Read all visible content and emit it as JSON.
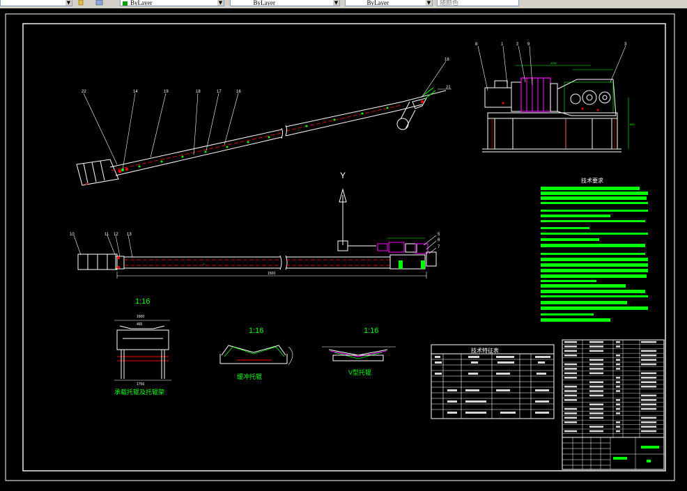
{
  "toolbar": {
    "layer_color": "ByLayer",
    "linetype": "ByLayer",
    "lineweight": "ByLayer",
    "plot_style": "随颜色",
    "layer_color_swatch": "#00a000"
  },
  "drawing": {
    "side_view_labels": [
      "22",
      "14",
      "19",
      "18",
      "17",
      "16",
      "18",
      "21"
    ],
    "plan_view_labels": [
      "10",
      "11",
      "12",
      "13",
      "1500",
      "5",
      "6",
      "7"
    ],
    "drive_labels": [
      "8",
      "1",
      "2",
      "9",
      "3",
      "1290",
      "850"
    ],
    "ucs_axis": "Y",
    "scale_1": "1:16",
    "scale_2": "1:16",
    "scale_3": "1:16",
    "detail_1_caption": "承载托辊及托辊架",
    "detail_2_caption": "缓冲托辊",
    "detail_3_caption": "V型托辊",
    "detail_1_dims": [
      "1600",
      "465",
      "1756"
    ],
    "tech_title": "技术要求",
    "params_title": "技术特征表",
    "colors": {
      "background": "#000000",
      "linework": "#ffffff",
      "green": "#00ff00",
      "red": "#ff0000",
      "magenta": "#ff00ff",
      "cyan": "#00ffff"
    }
  }
}
